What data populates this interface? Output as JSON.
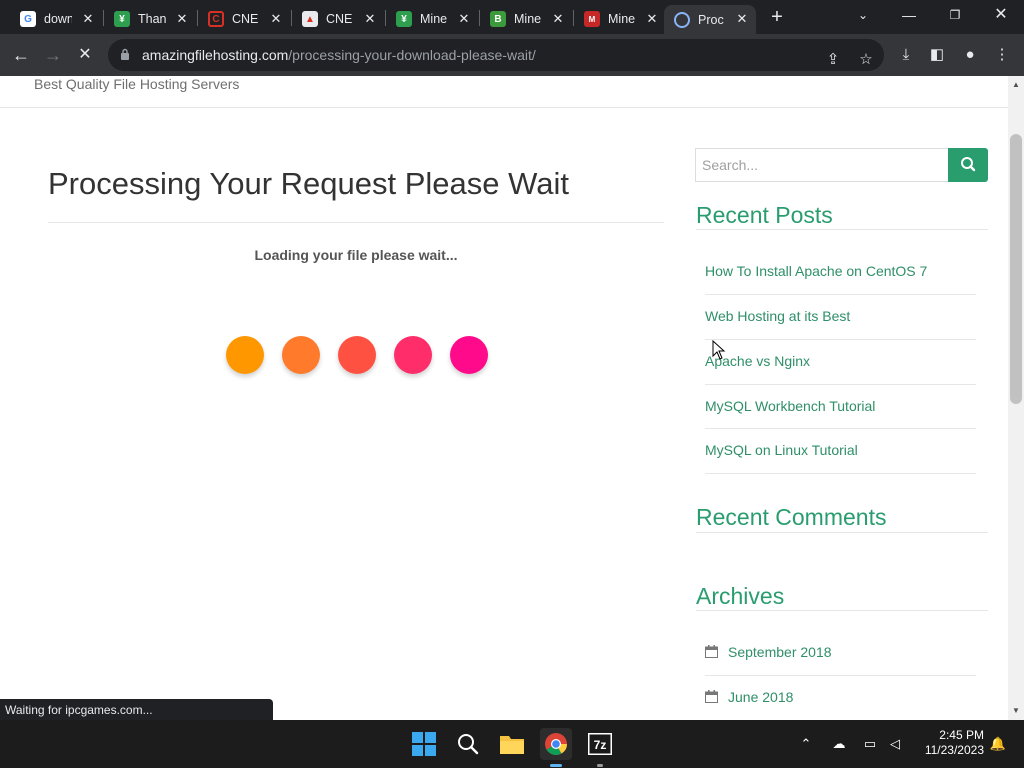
{
  "browser": {
    "tabs": [
      {
        "title": "down",
        "favicon": "google-icon",
        "color": "#ffffff"
      },
      {
        "title": "Than",
        "favicon": "green-download-icon",
        "color": "#2e9e4f"
      },
      {
        "title": "CNE",
        "favicon": "red-c-icon",
        "color": "#d93025"
      },
      {
        "title": "CNE",
        "favicon": "image-icon",
        "color": "#e8eaed"
      },
      {
        "title": "Mine",
        "favicon": "green-download-icon",
        "color": "#2e9e4f"
      },
      {
        "title": "Mine",
        "favicon": "green-b-icon",
        "color": "#3c9a3c"
      },
      {
        "title": "Mine",
        "favicon": "red-logo-icon",
        "color": "#c62828"
      },
      {
        "title": "Proc",
        "favicon": "loading-globe-icon",
        "color": "#8ab4f8"
      }
    ],
    "address": {
      "domain": "amazingfilehosting.com",
      "path": "/processing-your-download-please-wait/"
    },
    "status_text": "Waiting for ipcgames.com..."
  },
  "page": {
    "tagline": "Best Quality File Hosting Servers",
    "title": "Processing Your Request Please Wait",
    "loading_text": "Loading your file please wait...",
    "dots": [
      "#ff9800",
      "#ff7a2a",
      "#ff5142",
      "#ff2d6a",
      "#ff0a8a"
    ],
    "accent": "#2a9d6f"
  },
  "sidebar": {
    "search_placeholder": "Search...",
    "recent_posts_title": "Recent Posts",
    "recent_posts": [
      "How To Install Apache on CentOS 7",
      "Web Hosting at its Best",
      "Apache vs Nginx",
      "MySQL Workbench Tutorial",
      "MySQL on Linux Tutorial"
    ],
    "recent_comments_title": "Recent Comments",
    "archives_title": "Archives",
    "archives": [
      "September 2018",
      "June 2018"
    ]
  },
  "taskbar": {
    "time": "2:45 PM",
    "date": "11/23/2023"
  }
}
